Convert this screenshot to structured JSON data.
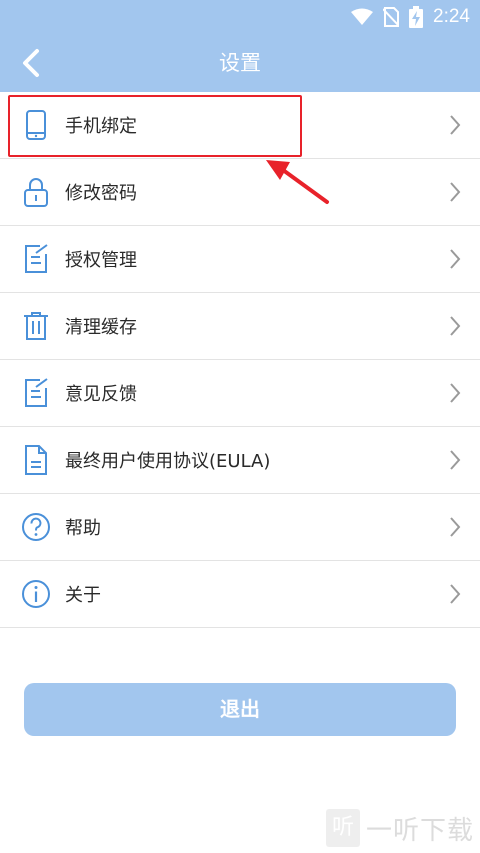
{
  "status_bar": {
    "time": "2:24",
    "icons": [
      "wifi-icon",
      "no-sim-icon",
      "battery-charging-icon"
    ]
  },
  "header": {
    "title": "设置",
    "back_icon": "back-chevron-icon"
  },
  "settings": [
    {
      "label": "手机绑定",
      "icon": "phone-icon"
    },
    {
      "label": "修改密码",
      "icon": "lock-icon"
    },
    {
      "label": "授权管理",
      "icon": "edit-note-icon"
    },
    {
      "label": "清理缓存",
      "icon": "trash-icon"
    },
    {
      "label": "意见反馈",
      "icon": "edit-note-icon"
    },
    {
      "label": "最终用户使用协议(EULA)",
      "icon": "document-icon"
    },
    {
      "label": "帮助",
      "icon": "help-icon"
    },
    {
      "label": "关于",
      "icon": "info-icon"
    }
  ],
  "logout_label": "退出",
  "watermark": {
    "logo_char": "听",
    "text": "一听下载"
  },
  "colors": {
    "header_bg": "#a2c6ee",
    "icon_stroke": "#4a90d9",
    "highlight": "#e8222a"
  }
}
